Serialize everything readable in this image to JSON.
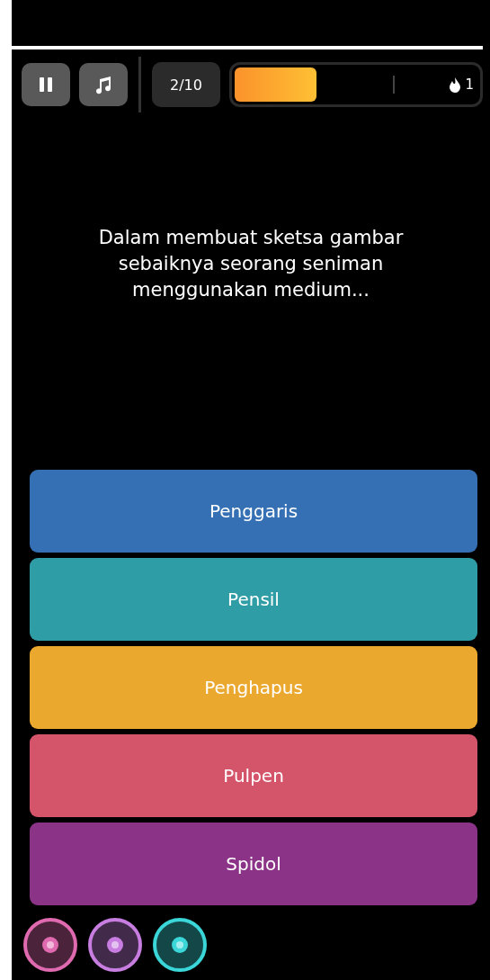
{
  "controls": {
    "counter": "2/10",
    "streak": "1"
  },
  "progress": {
    "level": 0.33
  },
  "question": "Dalam membuat sketsa gambar sebaiknya seorang seniman menggunakan medium...",
  "answers": [
    {
      "label": "Penggaris",
      "color": "#3470b3"
    },
    {
      "label": "Pensil",
      "color": "#2e9da6"
    },
    {
      "label": "Penghapus",
      "color": "#eba82f"
    },
    {
      "label": "Pulpen",
      "color": "#d4546a"
    },
    {
      "label": "Spidol",
      "color": "#8b3387"
    }
  ],
  "powerups": [
    {
      "color": "#e06ab0"
    },
    {
      "color": "#c77ee0"
    },
    {
      "color": "#3ad6d8"
    }
  ]
}
